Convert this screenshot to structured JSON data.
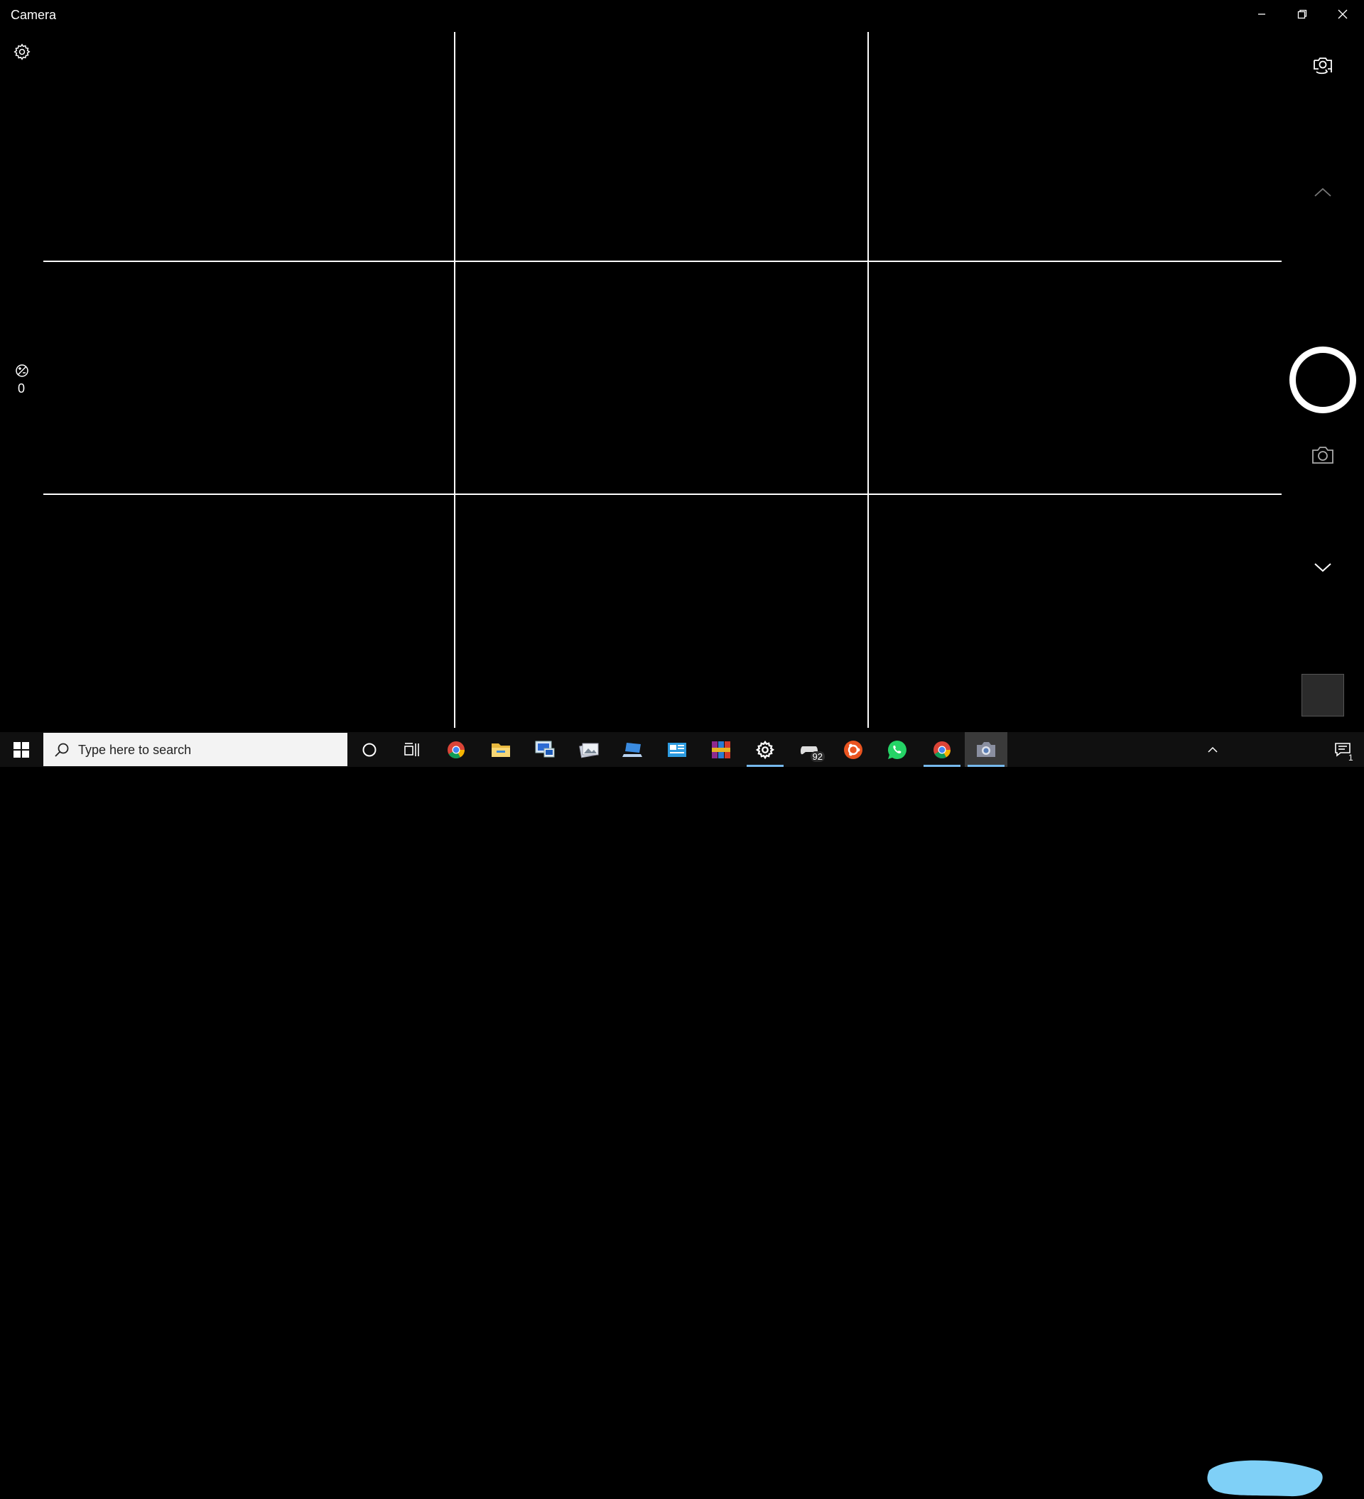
{
  "window": {
    "title": "Camera",
    "controls": [
      "minimize",
      "restore",
      "close"
    ]
  },
  "left_panel": {
    "settings_icon": "gear-icon",
    "exposure_icon": "exposure-icon",
    "exposure_value": "0"
  },
  "right_panel": {
    "switch_camera_icon": "switch-camera-icon",
    "expand_up_icon": "chevron-up-icon",
    "video_mode": {
      "icon": "video-camera-icon",
      "state": "active"
    },
    "photo_mode": {
      "icon": "camera-icon"
    },
    "collapse_icon": "chevron-down-icon",
    "thumbnail": "last-capture-thumbnail"
  },
  "framing_grid": {
    "rows": 3,
    "columns": 3,
    "color": "#ffffff"
  },
  "taskbar": {
    "search_placeholder": "Type here to search",
    "apps": [
      {
        "name": "cortana",
        "icon": "circle-icon"
      },
      {
        "name": "task-view",
        "icon": "task-view-icon"
      },
      {
        "name": "chrome-beta",
        "icon": "chrome-icon"
      },
      {
        "name": "file-explorer",
        "icon": "folder-icon"
      },
      {
        "name": "remote-desktop",
        "icon": "remote-desktop-icon"
      },
      {
        "name": "photos-app",
        "icon": "photos-icon"
      },
      {
        "name": "connect",
        "icon": "laptop-icon"
      },
      {
        "name": "news-app",
        "icon": "news-icon"
      },
      {
        "name": "winrar",
        "icon": "winrar-icon"
      },
      {
        "name": "settings",
        "icon": "gear-icon",
        "active": true
      },
      {
        "name": "game-app",
        "icon": "gamepad-icon",
        "badge": "92"
      },
      {
        "name": "ubuntu",
        "icon": "ubuntu-icon"
      },
      {
        "name": "whatsapp",
        "icon": "whatsapp-icon"
      },
      {
        "name": "chrome-profile",
        "icon": "chrome-icon",
        "active": true
      },
      {
        "name": "camera",
        "icon": "camera-icon",
        "active": true,
        "open": true
      }
    ],
    "notification_count": "1",
    "accent": "#76b9ed"
  }
}
